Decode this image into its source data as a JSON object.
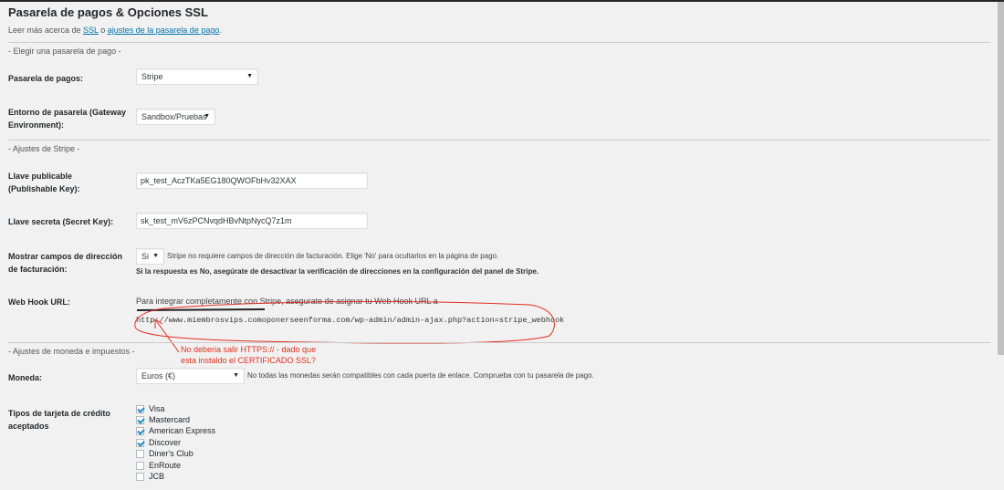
{
  "page": {
    "title": "Pasarela de pagos & Opciones SSL",
    "intro_prefix": "Leer más acerca de ",
    "intro_link_ssl": "SSL",
    "intro_mid": " o ",
    "intro_link_gateway": "ajustes de la pasarela de pago",
    "intro_suffix": "."
  },
  "sections": {
    "choose_gateway": "- Elegir una pasarela de pago -",
    "stripe_settings": "- Ajustes de Stripe -",
    "currency_tax": "- Ajustes de moneda e impuestos -"
  },
  "gateway": {
    "label": "Pasarela de pagos:",
    "value": "Stripe"
  },
  "environment": {
    "label": "Entorno de pasarela (Gateway Environment):",
    "value": "Sandbox/Pruebas"
  },
  "publishable_key": {
    "label": "Llave publicable (Publishable Key):",
    "value": "pk_test_AczTKa5EG180QWOFbHv32XAX"
  },
  "secret_key": {
    "label": "Llave secreta (Secret Key):",
    "value": "sk_test_mV6zPCNvqdHBvNtpNycQ7z1m"
  },
  "billing": {
    "label": "Mostrar campos de dirección de facturación:",
    "value": "Si",
    "note": "Stripe no requiere campos de dirección de facturación. Elige 'No' para ocultarlos en la página de pago.",
    "warning": "Si la respuesta es No, asegúrate de desactivar la verificación de direcciones en la configuración del panel de Stripe."
  },
  "webhook": {
    "label": "Web Hook URL:",
    "text": "Para integrar completamente con Stripe, asegurate de asignar tu Web Hook URL a",
    "url": "http://www.miembrosvips.comoponerseenforma.com/wp-admin/admin-ajax.php?action=stripe_webhook"
  },
  "annotation": {
    "line1": "No deberia salir HTTPS://     - dado que",
    "line2": "esta instaldo el CERTIFICADO SSL?",
    "color": "#e03020"
  },
  "currency": {
    "label": "Moneda:",
    "value": "Euros (€)",
    "note": "No todas las monedas serán compatibles con cada puerta de enlace. Comprueba con tu pasarela de pago."
  },
  "cards": {
    "label": "Tipos de tarjeta de crédito aceptados",
    "items": [
      {
        "label": "Visa",
        "checked": true
      },
      {
        "label": "Mastercard",
        "checked": true
      },
      {
        "label": "American Express",
        "checked": true
      },
      {
        "label": "Discover",
        "checked": true
      },
      {
        "label": "Diner's Club",
        "checked": false
      },
      {
        "label": "EnRoute",
        "checked": false
      },
      {
        "label": "JCB",
        "checked": false
      }
    ]
  },
  "icons": {
    "dropdown_arrow": "▼"
  }
}
